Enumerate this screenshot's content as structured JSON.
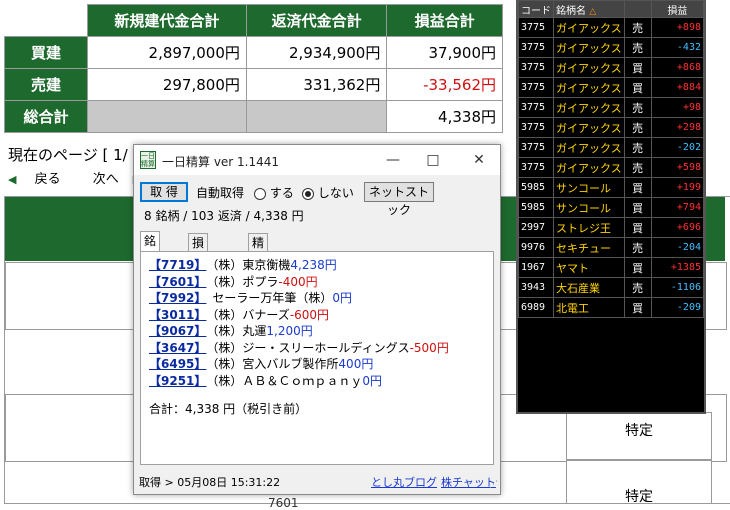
{
  "summary": {
    "headers": [
      "新規建代金合計",
      "返済代金合計",
      "損益合計"
    ],
    "rows": [
      {
        "label": "買建",
        "new": "2,897,000円",
        "repay": "2,934,900円",
        "pl": "37,900円"
      },
      {
        "label": "売建",
        "new": "297,800円",
        "repay": "331,362円",
        "pl": "-33,562円"
      },
      {
        "label": "総合計",
        "new": "",
        "repay": "",
        "pl": "4,338円"
      }
    ]
  },
  "page": {
    "current": "現在のページ [ 1/",
    "back": "戻る",
    "next": "次へ",
    "tokutei": [
      "特定",
      "特定"
    ],
    "partial_number": "7601"
  },
  "stock_list": {
    "headers": {
      "code": "コード",
      "name": "銘柄名",
      "side": "",
      "pl": "損益"
    },
    "rows": [
      {
        "code": "3775",
        "name": "ガイアックス",
        "side": "売",
        "pl": "+898"
      },
      {
        "code": "3775",
        "name": "ガイアックス",
        "side": "売",
        "pl": "-432"
      },
      {
        "code": "3775",
        "name": "ガイアックス",
        "side": "買",
        "pl": "+868"
      },
      {
        "code": "3775",
        "name": "ガイアックス",
        "side": "買",
        "pl": "+884"
      },
      {
        "code": "3775",
        "name": "ガイアックス",
        "side": "売",
        "pl": "+98"
      },
      {
        "code": "3775",
        "name": "ガイアックス",
        "side": "売",
        "pl": "+298"
      },
      {
        "code": "3775",
        "name": "ガイアックス",
        "side": "売",
        "pl": "-202"
      },
      {
        "code": "3775",
        "name": "ガイアックス",
        "side": "売",
        "pl": "+598"
      },
      {
        "code": "5985",
        "name": "サンコール",
        "side": "買",
        "pl": "+199"
      },
      {
        "code": "5985",
        "name": "サンコール",
        "side": "買",
        "pl": "+794"
      },
      {
        "code": "2997",
        "name": "ストレジ王",
        "side": "買",
        "pl": "+696"
      },
      {
        "code": "9976",
        "name": "セキチュー",
        "side": "売",
        "pl": "-204"
      },
      {
        "code": "1967",
        "name": "ヤマト",
        "side": "買",
        "pl": "+1385"
      },
      {
        "code": "3943",
        "name": "大石産業",
        "side": "売",
        "pl": "-1106"
      },
      {
        "code": "6989",
        "name": "北電工",
        "side": "買",
        "pl": "-209"
      }
    ]
  },
  "popup": {
    "icon_text": "一日精算",
    "title": "一日精算 ver 1.1441",
    "fetch_button": "取 得",
    "auto_label": "自動取得",
    "radio_on": "する",
    "radio_off": "しない",
    "netstock_button": "ネットストック",
    "summary": "8 銘柄 / 103 返済 / 4,338 円",
    "tabs": [
      "銘柄別",
      "損益推移",
      "精算表"
    ],
    "items": [
      {
        "code": "【7719】",
        "name": "（株）東京衡機",
        "pl": "4,238円",
        "neg": false
      },
      {
        "code": "【7601】",
        "name": "（株）ポプラ",
        "pl": "-400円",
        "neg": true
      },
      {
        "code": "【7992】",
        "name": "セーラー万年筆（株）",
        "pl": "0円",
        "neg": false
      },
      {
        "code": "【3011】",
        "name": "（株）バナーズ",
        "pl": "-600円",
        "neg": true
      },
      {
        "code": "【9067】",
        "name": "（株）丸運",
        "pl": "1,200円",
        "neg": false
      },
      {
        "code": "【3647】",
        "name": "（株）ジー・スリーホールディングス",
        "pl": "-500円",
        "neg": true
      },
      {
        "code": "【6495】",
        "name": "（株）宮入バルブ製作所",
        "pl": "400円",
        "neg": false
      },
      {
        "code": "【9251】",
        "name": "（株）ＡＢ＆Ｃｏｍｐａｎｙ",
        "pl": "0円",
        "neg": false
      }
    ],
    "total": "合計：4,338 円（税引き前）",
    "status": "取得 > 05月08日 15:31:22",
    "link_blog": "とし丸ブログ",
    "link_chart": "株チャット"
  }
}
